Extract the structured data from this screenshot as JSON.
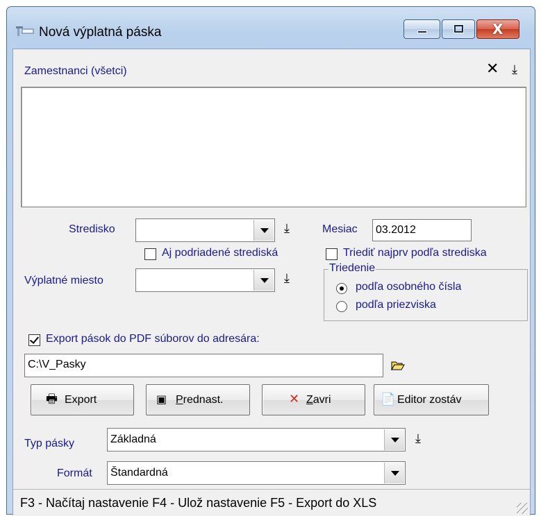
{
  "window": {
    "title": "Nová výplatná páska",
    "caption_close": "X"
  },
  "employees": {
    "label": "Zamestnanci (všetci)",
    "items": []
  },
  "stredisko": {
    "label": "Stredisko",
    "value": "",
    "include_sub_label": "Aj podriadené strediská",
    "include_sub_checked": false
  },
  "mesiac": {
    "label": "Mesiac",
    "value": "03.2012"
  },
  "sort_by_center": {
    "label": "Triediť najprv podľa strediska",
    "checked": false
  },
  "vyplatne_miesto": {
    "label": "Výplatné miesto",
    "value": ""
  },
  "triedenie": {
    "legend": "Triedenie",
    "options": [
      {
        "label": "podľa osobného čísla",
        "selected": true
      },
      {
        "label": "podľa priezviska",
        "selected": false
      }
    ]
  },
  "export_pdf": {
    "label": "Export pások do PDF súborov do adresára:",
    "checked": true,
    "path": "C:\\V_Pasky"
  },
  "buttons": {
    "export": "Export",
    "prednast_first": "P",
    "prednast_rest": "rednast.",
    "zavri_first": "Z",
    "zavri_rest": "avri",
    "editor": "Editor zostáv"
  },
  "typ_pasky": {
    "label": "Typ pásky",
    "value": "Základná"
  },
  "format": {
    "label": "Formát",
    "value": "Štandardná"
  },
  "statusbar": {
    "text": "F3 - Načítaj nastavenie   F4 - Ulož nastavenie   F5 - Export do XLS"
  },
  "colors": {
    "label_blue": "#1a1a8c",
    "close_red": "#c43d24"
  }
}
